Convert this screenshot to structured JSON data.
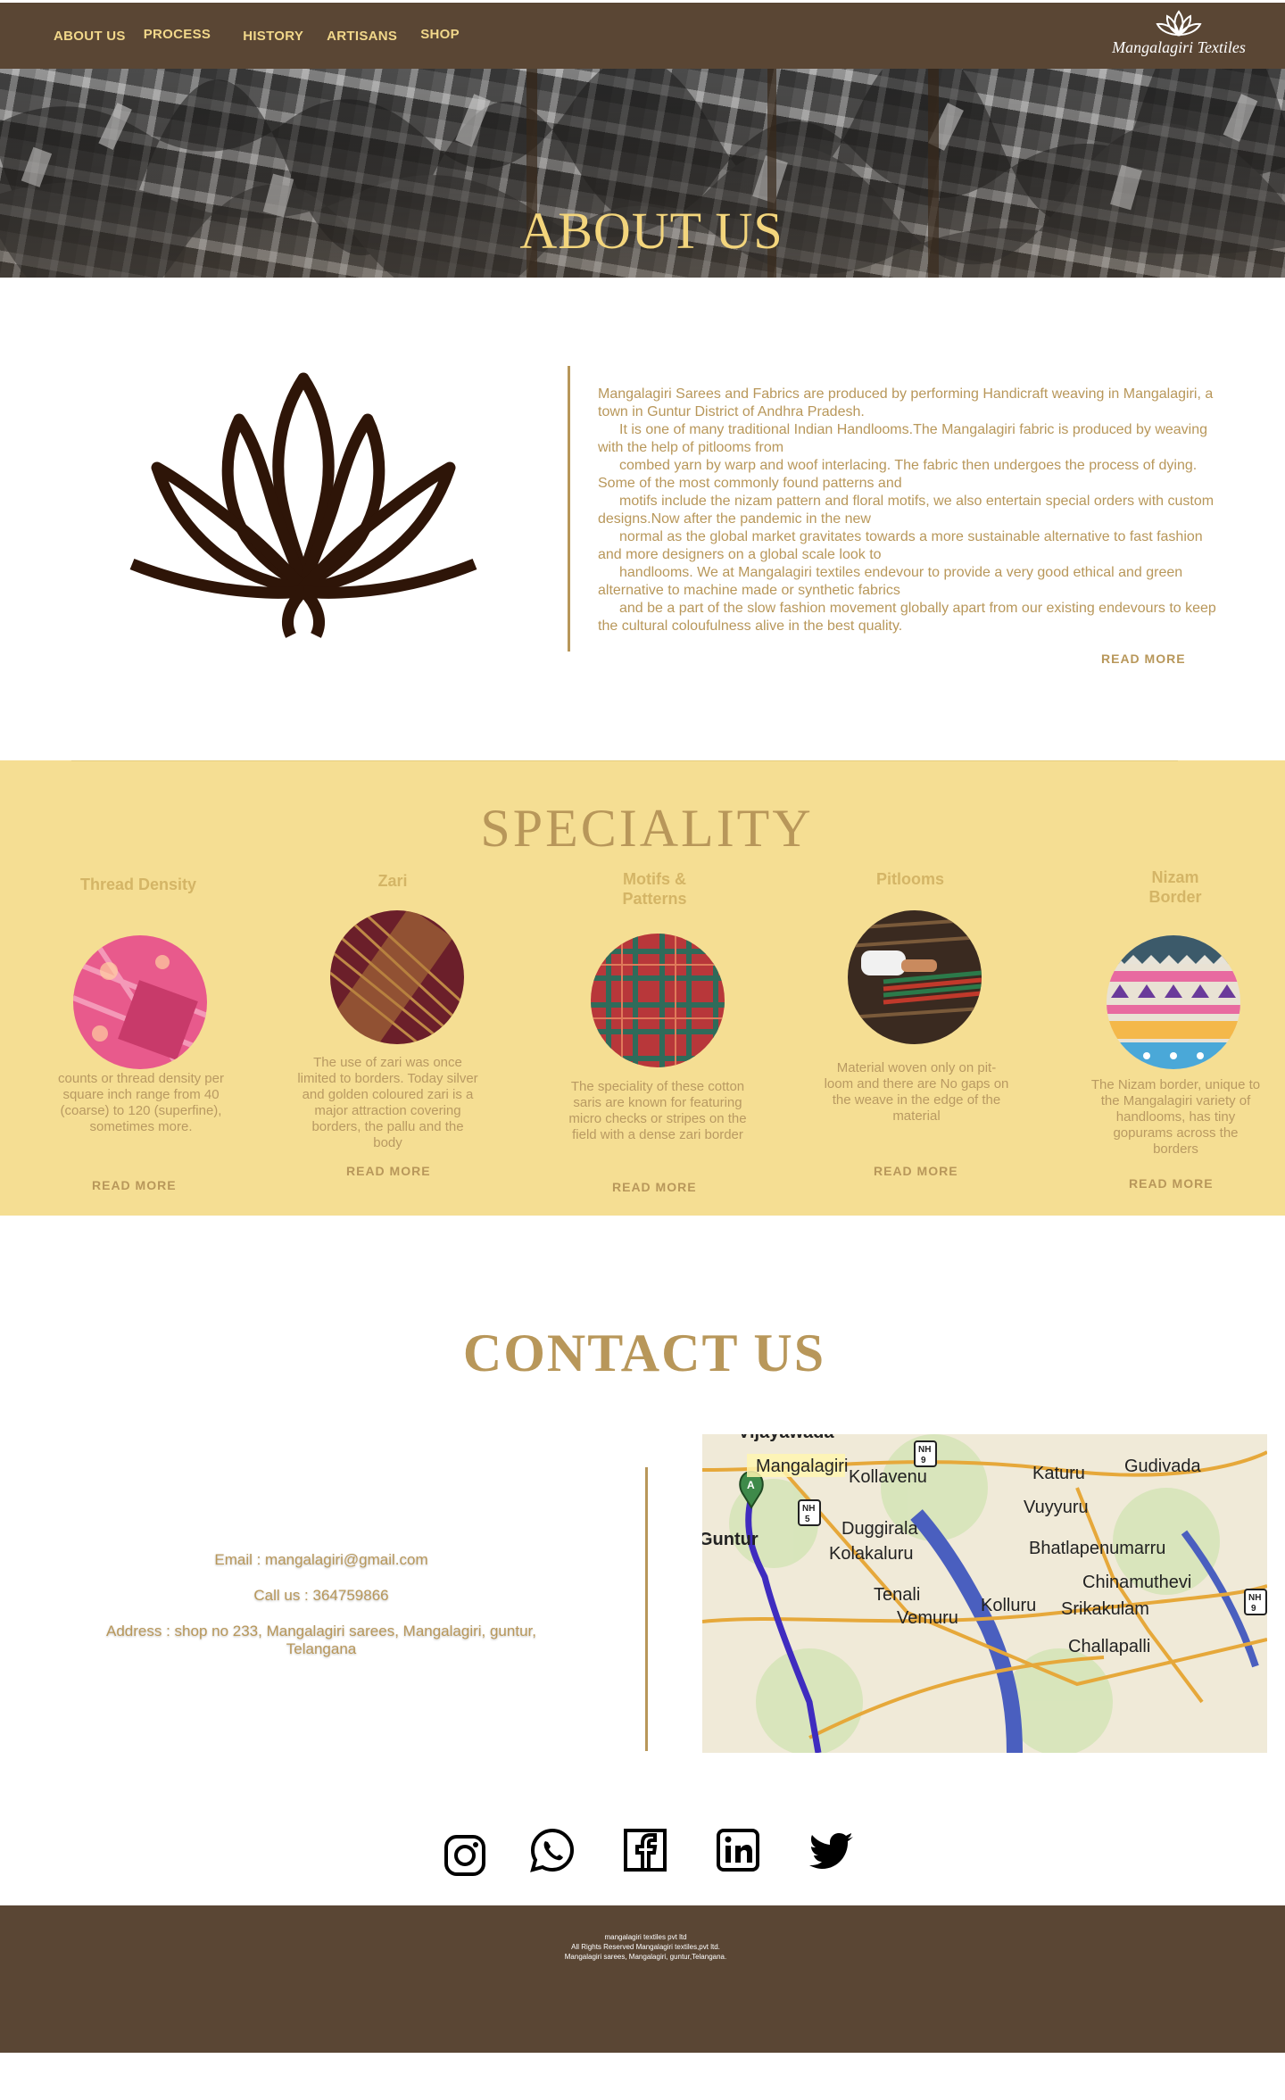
{
  "nav": {
    "links": [
      "ABOUT US",
      "PROCESS",
      "HISTORY",
      "ARTISANS",
      "SHOP"
    ],
    "logo_text": "Mangalagiri Textiles"
  },
  "hero": {
    "title": "ABOUT US"
  },
  "about": {
    "paragraphs": [
      "Mangalagiri Sarees and Fabrics are produced by performing Handicraft weaving in Mangalagiri, a town in Guntur District of Andhra Pradesh.",
      "It is one of many traditional Indian Handlooms.The Mangalagiri fabric is produced by weaving with the help of pitlooms from",
      "combed yarn by warp and woof interlacing. The fabric then undergoes the process of dying. Some of the most commonly found patterns and",
      "motifs include the nizam pattern and floral motifs, we also entertain special orders with custom designs.Now after the pandemic in the new",
      "normal as the global market gravitates towards a more sustainable alternative to fast fashion and  more designers on a global scale look to",
      "handlooms. We at Mangalagiri textiles endevour to  provide a very good ethical and  green alternative to machine made or synthetic fabrics",
      "and be a part of the slow fashion movement globally apart from our existing endevours to keep the cultural coloufulness alive in the best quality."
    ],
    "read_more": "READ  MORE"
  },
  "speciality": {
    "title": "SPECIALITY",
    "items": [
      {
        "heading": "Thread Density",
        "desc": "counts or thread density per square inch range from 40 (coarse) to 120 (superfine), sometimes more.",
        "read_more": "READ  MORE"
      },
      {
        "heading": "Zari",
        "desc": "The use of zari was once limited to borders. Today silver and golden coloured zari is a major attraction covering borders, the pallu and the body",
        "read_more": "READ  MORE"
      },
      {
        "heading": "Motifs & Patterns",
        "desc": "The speciality of these cotton saris are known for featuring micro checks or stripes on the field with a dense zari border",
        "read_more": "READ  MORE"
      },
      {
        "heading": "Pitlooms",
        "desc": "Material woven only on pit-loom and there are No gaps on the weave in the edge of the material",
        "read_more": "READ  MORE"
      },
      {
        "heading": "Nizam Border",
        "desc": "The Nizam border, unique to the Mangalagiri variety of handlooms, has tiny gopurams across the borders",
        "read_more": "READ  MORE"
      }
    ]
  },
  "contact": {
    "title": "CONTACT US",
    "email": "Email : mangalagiri@gmail.com",
    "phone": "Call us : 364759866",
    "address": "Address : shop no 233, Mangalagiri sarees, Mangalagiri, guntur, Telangana",
    "map_labels": [
      "Vijayawada",
      "Mangalagiri",
      "Kollavenu",
      "Katuru",
      "Gudivada",
      "Vuyyuru",
      "Duggirala",
      "Guntur",
      "Kolakaluru",
      "Bhatlapenumarru",
      "Chinamuthevi",
      "Tenali",
      "Kolluru",
      "Srikakulam",
      "Vemuru",
      "Challapalli",
      "NH",
      "9",
      "5",
      "A"
    ]
  },
  "social": [
    "instagram-icon",
    "whatsapp-icon",
    "facebook-icon",
    "linkedin-icon",
    "twitter-icon"
  ],
  "footer": {
    "lines": [
      "mangalagiri textiles pvt ltd",
      "All Rights Reserved Mangalagiri textiles,pvt ltd.",
      "Mangalagiri sarees, Mangalagiri, guntur,Telangana."
    ]
  },
  "colors": {
    "brown": "#5a4634",
    "gold": "#b8975a",
    "nav_gold": "#f1d78a",
    "cream": "#f5de93"
  }
}
